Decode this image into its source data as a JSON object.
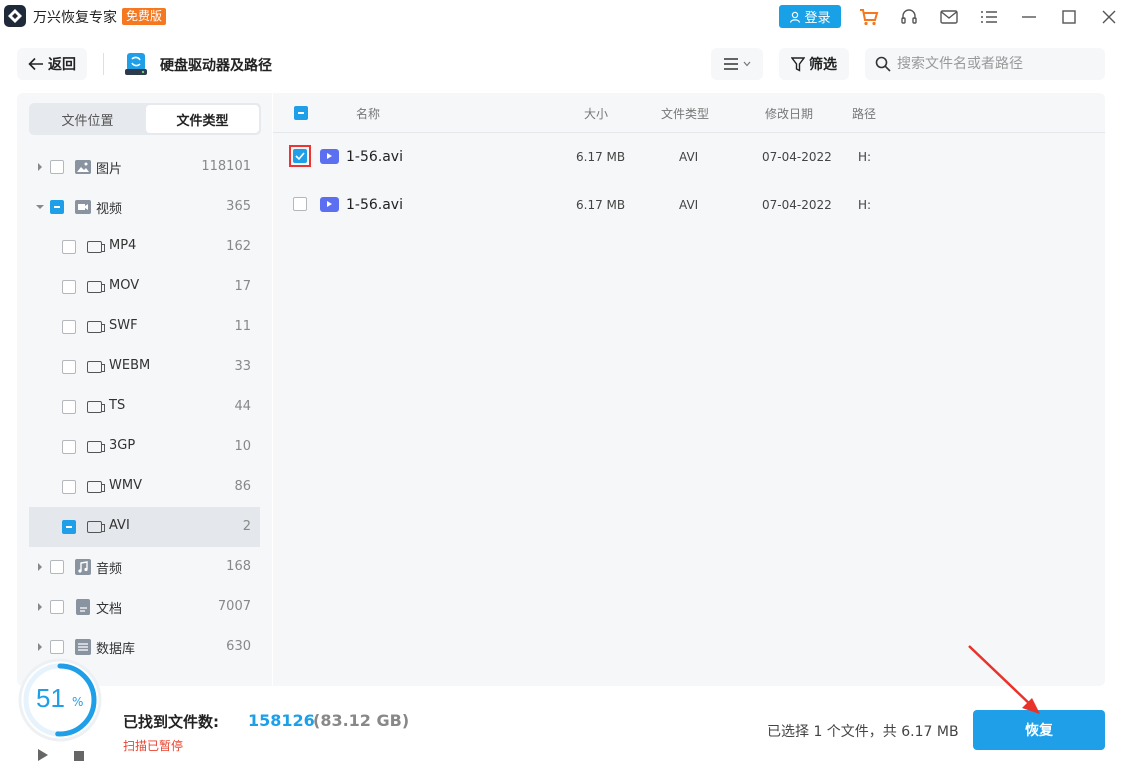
{
  "titlebar": {
    "app_title": "万兴恢复专家",
    "edition_badge": "免费版",
    "login_label": "登录",
    "icons": [
      "cart-icon",
      "headset-icon",
      "mail-icon",
      "menu-icon",
      "minimize-icon",
      "maximize-icon",
      "close-icon"
    ]
  },
  "toolbar": {
    "back_label": "返回",
    "page_title": "硬盘驱动器及路径",
    "filter_label": "筛选",
    "search_placeholder": "搜索文件名或者路径"
  },
  "sidebar": {
    "tabs": [
      {
        "label": "文件位置",
        "active": false
      },
      {
        "label": "文件类型",
        "active": true
      }
    ],
    "categories": [
      {
        "label": "图片",
        "count": "118101",
        "expanded": false,
        "check": "none"
      },
      {
        "label": "视频",
        "count": "365",
        "expanded": true,
        "check": "partial"
      },
      {
        "label": "MP4",
        "count": "162",
        "check": "none"
      },
      {
        "label": "MOV",
        "count": "17",
        "check": "none"
      },
      {
        "label": "SWF",
        "count": "11",
        "check": "none"
      },
      {
        "label": "WEBM",
        "count": "33",
        "check": "none"
      },
      {
        "label": "TS",
        "count": "44",
        "check": "none"
      },
      {
        "label": "3GP",
        "count": "10",
        "check": "none"
      },
      {
        "label": "WMV",
        "count": "86",
        "check": "none"
      },
      {
        "label": "AVI",
        "count": "2",
        "check": "partial",
        "selected": true
      },
      {
        "label": "音频",
        "count": "168",
        "expanded": false,
        "check": "none"
      },
      {
        "label": "文档",
        "count": "7007",
        "expanded": false,
        "check": "none"
      },
      {
        "label": "数据库",
        "count": "630",
        "expanded": false,
        "check": "none"
      }
    ]
  },
  "table": {
    "columns": [
      "名称",
      "大小",
      "文件类型",
      "修改日期",
      "路径"
    ],
    "rows": [
      {
        "name": "1-56.avi",
        "size": "6.17 MB",
        "type": "AVI",
        "date": "07-04-2022",
        "path": "H:",
        "checked": true
      },
      {
        "name": "1-56.avi",
        "size": "6.17 MB",
        "type": "AVI",
        "date": "07-04-2022",
        "path": "H:",
        "checked": false
      }
    ]
  },
  "footer": {
    "progress_percent": "51",
    "percent_sign": "%",
    "found_label": "已找到文件数:",
    "found_count": "158126",
    "found_size": "(83.12 GB)",
    "scan_status": "扫描已暂停",
    "selection_summary": "已选择 1 个文件，共 6.17 MB",
    "recover_label": "恢复"
  },
  "colors": {
    "accent": "#1e9fe8",
    "badge": "#f5771f",
    "warning_text": "#e8432f",
    "panel_bg": "#f5f7f9"
  }
}
